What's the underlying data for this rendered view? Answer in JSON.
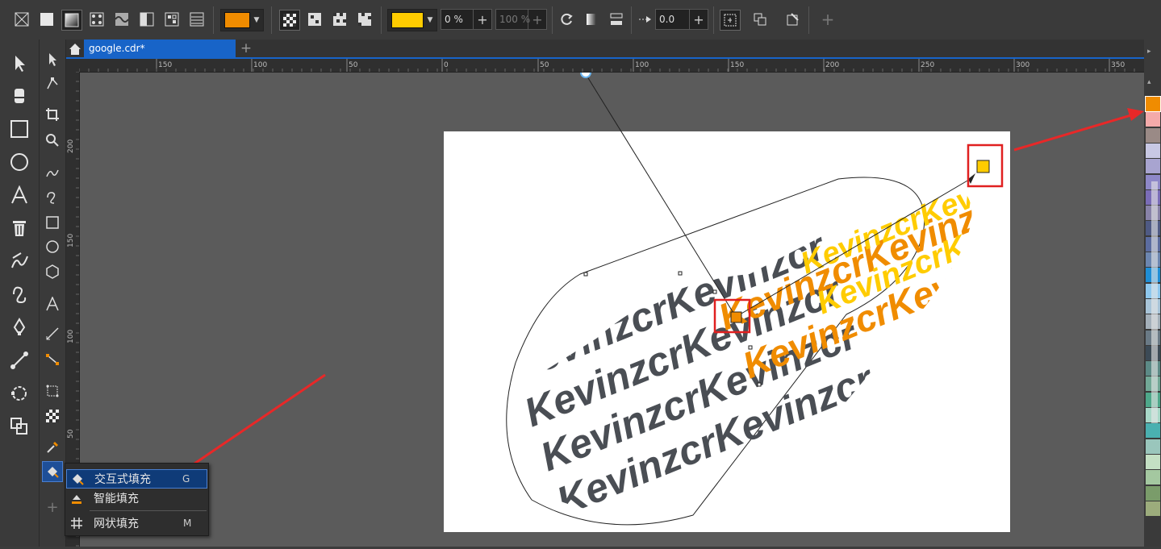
{
  "document": {
    "tab_label": "google.cdr*"
  },
  "property_bar": {
    "fill_color_1": "#f08c00",
    "fill_color_2": "#ffcc00",
    "transparency_value": "0 %",
    "node_transparency_value": "100 %",
    "acceleration_value": "0.0"
  },
  "ruler": {
    "h_labels": [
      "150",
      "100",
      "50",
      "0",
      "50",
      "100",
      "150",
      "200",
      "250",
      "300",
      "350"
    ],
    "v_labels": [
      "200",
      "150",
      "100",
      "50"
    ]
  },
  "flyout": {
    "items": [
      {
        "label": "交互式填充",
        "shortcut": "G"
      },
      {
        "label": "智能填充",
        "shortcut": ""
      },
      {
        "label": "网状填充",
        "shortcut": "M"
      }
    ]
  },
  "artwork": {
    "text": "Kevinzcr",
    "gray": "#4a4e54",
    "orange": "#f08c00",
    "yellow": "#ffcc00"
  },
  "palette": [
    "#f08c00",
    "#f4aaaa",
    "#9a8a86",
    "#c8c8e4",
    "#a8a4d0",
    "#8e88c8",
    "#7a6cb8",
    "#8882a8",
    "#4f5a84",
    "#5b6ca0",
    "#6c86b0",
    "#1f8ed6",
    "#8ec8ee",
    "#a8c4d8",
    "#a4b0ba",
    "#6a7a86",
    "#3c4a56",
    "#5c8a86",
    "#72a896",
    "#4ea88a",
    "#a8d8c8",
    "#4ab0b0",
    "#9ac6bc",
    "#c4e0c4",
    "#a4c8a0",
    "#7a9c6a",
    "#9cac7c"
  ],
  "colors": {
    "accent": "#1864c8",
    "highlight_box": "#e02020",
    "arrow": "#e82828"
  }
}
